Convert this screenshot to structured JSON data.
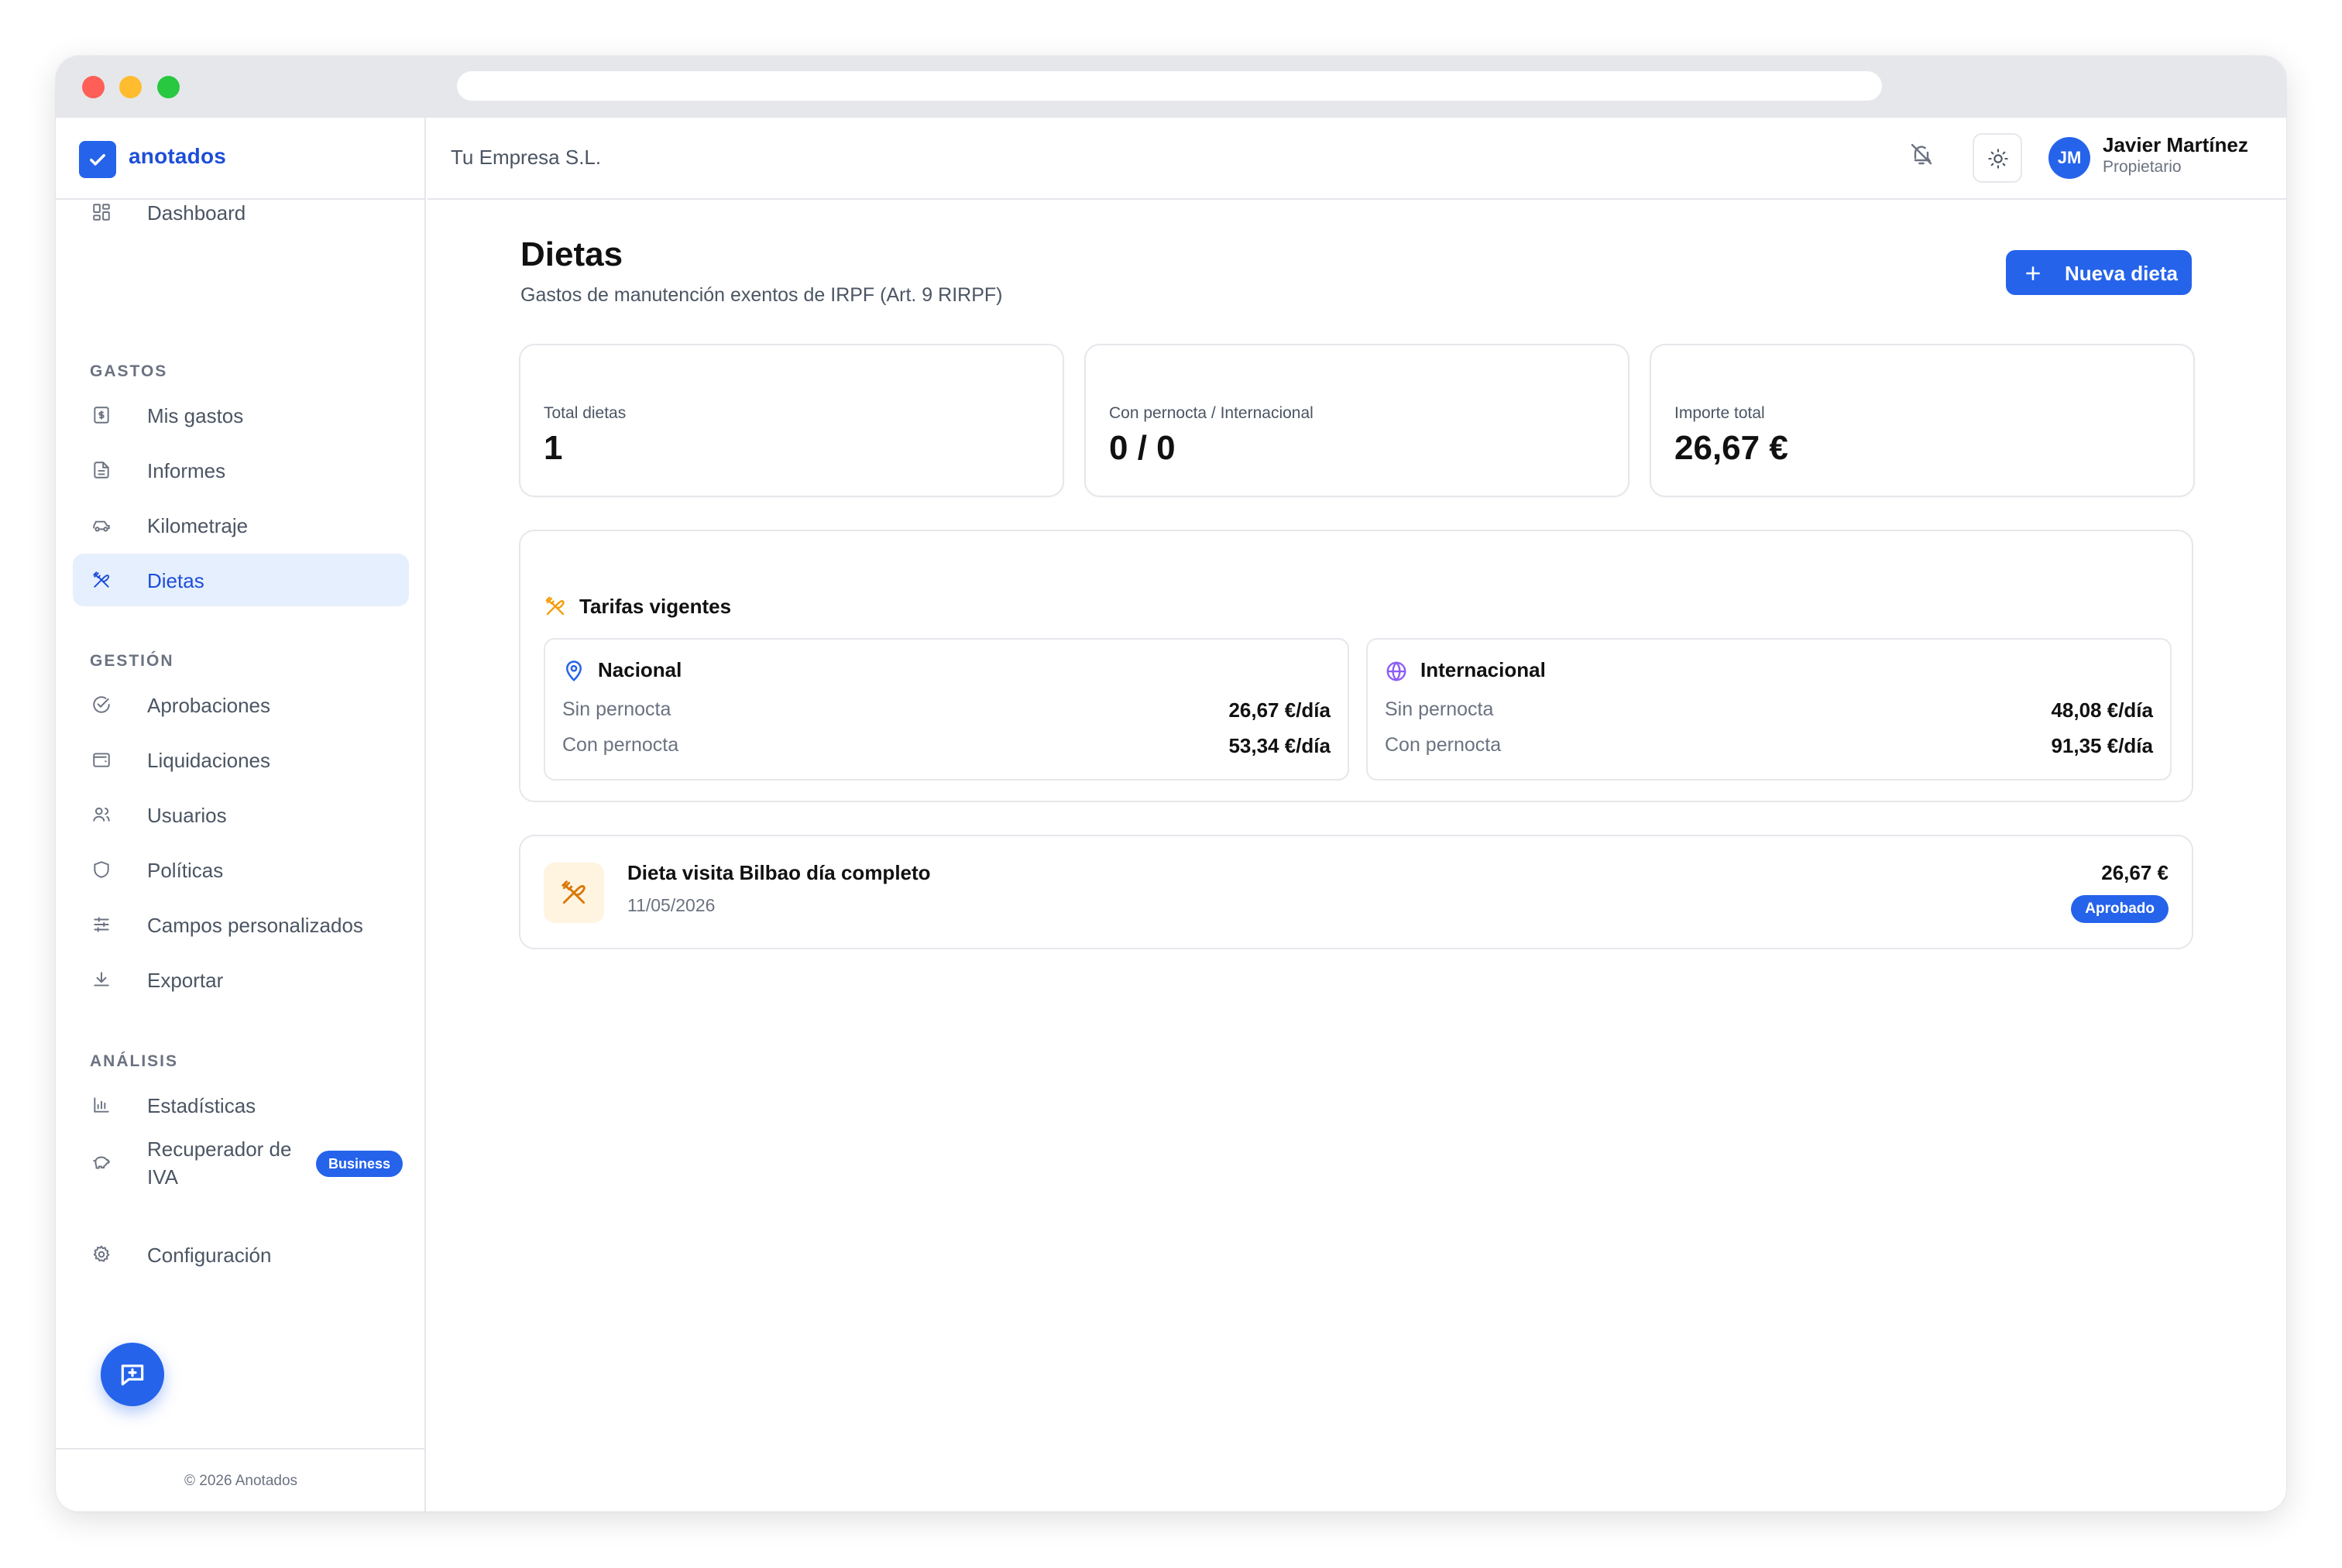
{
  "app": {
    "logo_text": "anotados",
    "company": "Tu Empresa S.L.",
    "copyright": "© 2026 Anotados"
  },
  "user": {
    "initials": "JM",
    "name": "Javier Martínez",
    "role": "Propietario"
  },
  "sidebar": {
    "dashboard": {
      "label": "Dashboard",
      "icon": "grid-icon"
    },
    "sections": [
      {
        "title": "GASTOS",
        "items": [
          {
            "label": "Mis gastos",
            "icon": "receipt-icon"
          },
          {
            "label": "Informes",
            "icon": "document-icon"
          },
          {
            "label": "Kilometraje",
            "icon": "car-icon"
          },
          {
            "label": "Dietas",
            "icon": "utensils-icon",
            "active": true
          }
        ]
      },
      {
        "title": "GESTIÓN",
        "items": [
          {
            "label": "Aprobaciones",
            "icon": "check-circle-icon"
          },
          {
            "label": "Liquidaciones",
            "icon": "wallet-icon"
          },
          {
            "label": "Usuarios",
            "icon": "users-icon"
          },
          {
            "label": "Políticas",
            "icon": "shield-icon"
          },
          {
            "label": "Campos personalizados",
            "icon": "sliders-icon"
          },
          {
            "label": "Exportar",
            "icon": "download-icon"
          }
        ]
      },
      {
        "title": "ANÁLISIS",
        "items": [
          {
            "label": "Estadísticas",
            "icon": "bar-chart-icon"
          },
          {
            "label": "Recuperador de IVA",
            "icon": "piggy-bank-icon",
            "badge": "Business"
          }
        ]
      }
    ],
    "settings": {
      "label": "Configuración",
      "icon": "gear-icon"
    }
  },
  "page": {
    "title": "Dietas",
    "subtitle": "Gastos de manutención exentos de IRPF (Art. 9 RIRPF)",
    "new_button": "Nueva dieta"
  },
  "stats": [
    {
      "label": "Total dietas",
      "value": "1"
    },
    {
      "label": "Con pernocta / Internacional",
      "value": "0 / 0"
    },
    {
      "label": "Importe total",
      "value": "26,67 €"
    }
  ],
  "tarifas": {
    "title": "Tarifas vigentes",
    "nacional": {
      "title": "Nacional",
      "rows": [
        {
          "label": "Sin pernocta",
          "value": "26,67 €/día"
        },
        {
          "label": "Con pernocta",
          "value": "53,34 €/día"
        }
      ]
    },
    "internacional": {
      "title": "Internacional",
      "rows": [
        {
          "label": "Sin pernocta",
          "value": "48,08 €/día"
        },
        {
          "label": "Con pernocta",
          "value": "91,35 €/día"
        }
      ]
    }
  },
  "dietas": [
    {
      "title": "Dieta visita Bilbao día completo",
      "date": "11/05/2026",
      "amount": "26,67 €",
      "status": "Aprobado"
    }
  ],
  "colors": {
    "accent": "#2563eb",
    "active_bg": "#e6effd",
    "orange_icon": "#f59e0b",
    "purple_icon": "#8b5cf6"
  }
}
